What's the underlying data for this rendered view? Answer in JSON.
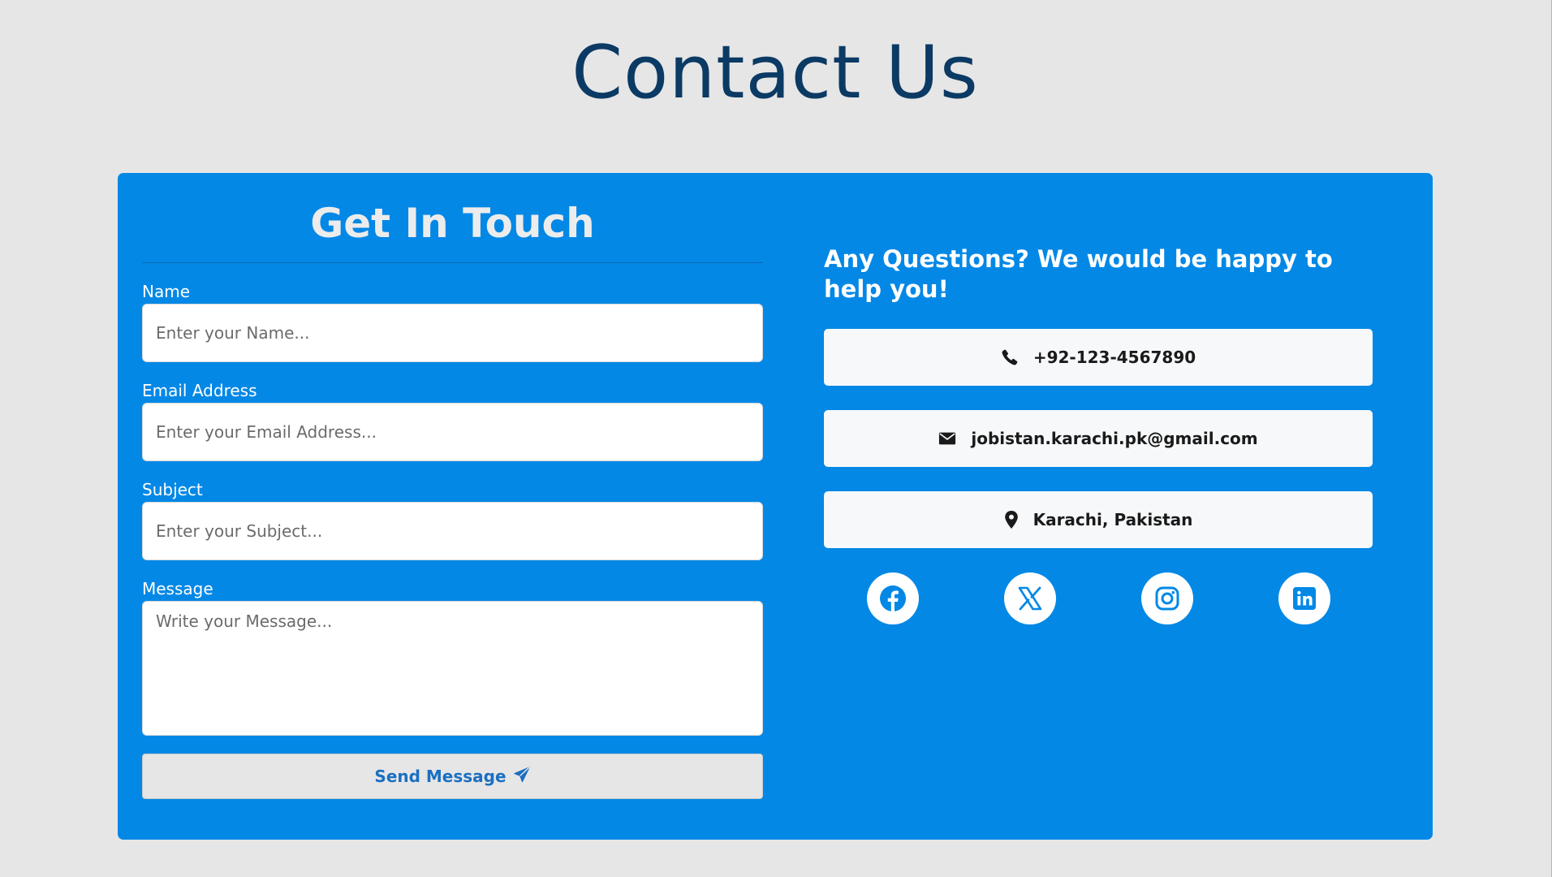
{
  "page": {
    "title": "Contact Us"
  },
  "form": {
    "title": "Get In Touch",
    "fields": {
      "name": {
        "label": "Name",
        "placeholder": "Enter your Name..."
      },
      "email": {
        "label": "Email Address",
        "placeholder": "Enter your Email Address..."
      },
      "subject": {
        "label": "Subject",
        "placeholder": "Enter your Subject..."
      },
      "message": {
        "label": "Message",
        "placeholder": "Write your Message..."
      }
    },
    "submit_label": "Send Message",
    "submit_icon": "paper-plane-icon"
  },
  "info": {
    "heading": "Any Questions? We would be happy to help you!",
    "phone": {
      "icon": "phone-icon",
      "text": "+92-123-4567890"
    },
    "email": {
      "icon": "envelope-icon",
      "text": "jobistan.karachi.pk@gmail.com"
    },
    "location": {
      "icon": "map-pin-icon",
      "text": "Karachi, Pakistan"
    },
    "social": [
      {
        "name": "facebook",
        "icon": "facebook-icon"
      },
      {
        "name": "x",
        "icon": "x-twitter-icon"
      },
      {
        "name": "instagram",
        "icon": "instagram-icon"
      },
      {
        "name": "linkedin",
        "icon": "linkedin-icon"
      }
    ]
  },
  "colors": {
    "page_background": "#e6e6e6",
    "card_background": "#0388e6",
    "title_text": "#0b3a64",
    "icon_blue": "#0388e6",
    "button_text": "#1a6fc2"
  }
}
